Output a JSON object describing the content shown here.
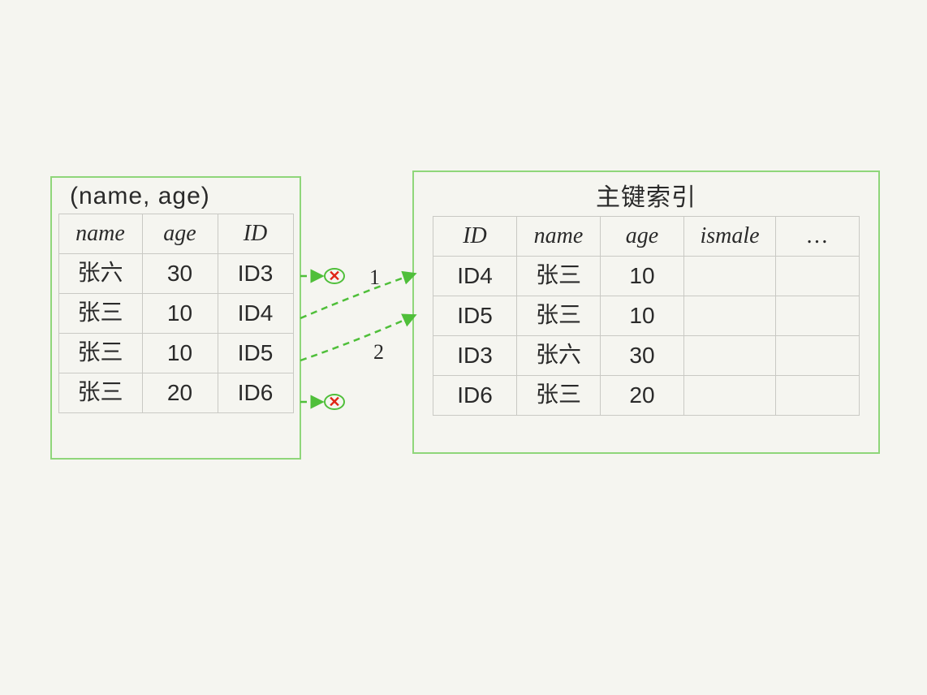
{
  "left_index": {
    "title": "(name, age)",
    "columns": [
      "name",
      "age",
      "ID"
    ],
    "rows": [
      {
        "name": "张六",
        "age": "30",
        "id": "ID3",
        "reject": true
      },
      {
        "name": "张三",
        "age": "10",
        "id": "ID4",
        "reject": false,
        "arrow_label": "1"
      },
      {
        "name": "张三",
        "age": "10",
        "id": "ID5",
        "reject": false,
        "arrow_label": "2"
      },
      {
        "name": "张三",
        "age": "20",
        "id": "ID6",
        "reject": true
      }
    ]
  },
  "right_index": {
    "title": "主键索引",
    "columns": [
      "ID",
      "name",
      "age",
      "ismale",
      "…"
    ],
    "rows": [
      {
        "id": "ID4",
        "name": "张三",
        "age": "10",
        "ismale": "",
        "rest": ""
      },
      {
        "id": "ID5",
        "name": "张三",
        "age": "10",
        "ismale": "",
        "rest": ""
      },
      {
        "id": "ID3",
        "name": "张六",
        "age": "30",
        "ismale": "",
        "rest": ""
      },
      {
        "id": "ID6",
        "name": "张三",
        "age": "20",
        "ismale": "",
        "rest": ""
      }
    ]
  },
  "arrows": {
    "label1": "1",
    "label2": "2"
  }
}
